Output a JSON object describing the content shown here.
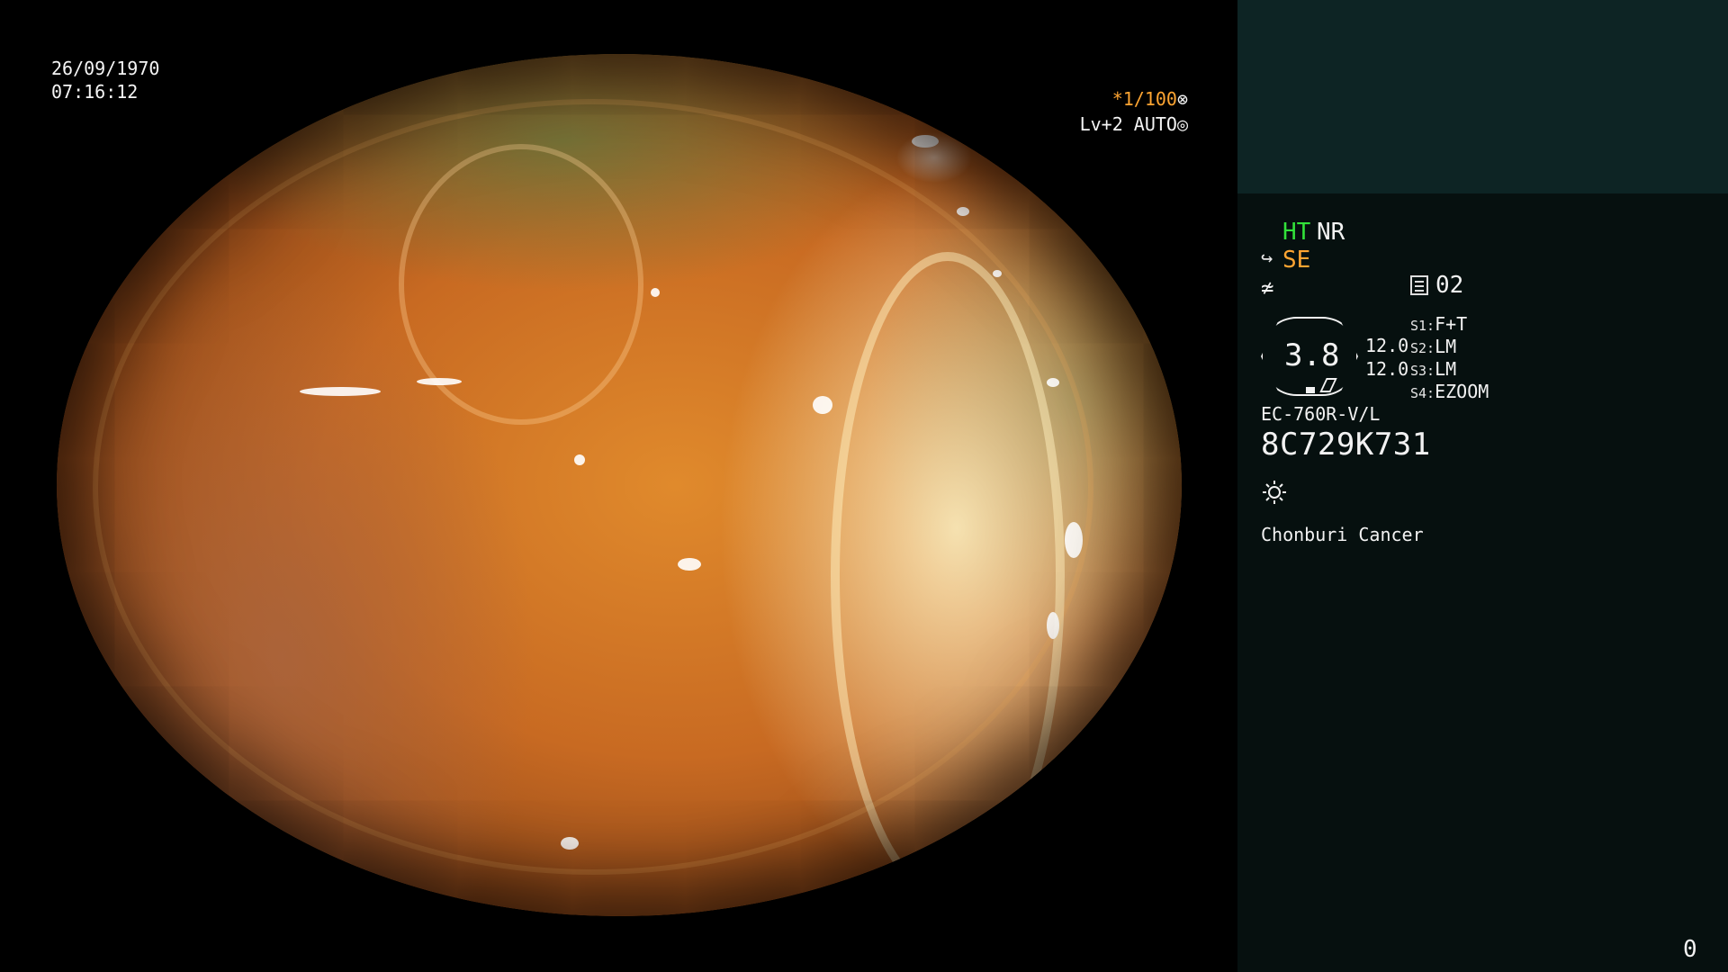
{
  "overlay": {
    "date": "26/09/1970",
    "time": "07:16:12",
    "shutter": "*1/100",
    "shutter_icon": "aperture-icon",
    "iris_mode": "Lv+2 AUTO",
    "iris_icon": "iris-icon"
  },
  "panel": {
    "ht": "HT",
    "nr": "NR",
    "se": "SE",
    "memo_number": "02",
    "zoom": "3.8",
    "mag_top": "12.0",
    "mag_bottom": "12.0",
    "switches": [
      {
        "key": "S1:",
        "value": "F+T"
      },
      {
        "key": "S2:",
        "value": "LM"
      },
      {
        "key": "S3:",
        "value": "LM"
      },
      {
        "key": "S4:",
        "value": "EZOOM"
      }
    ],
    "scope_model": "EC-760R-V/L",
    "serial": "8C729K731",
    "hospital": "Chonburi Cancer",
    "page_counter": "0"
  },
  "colors": {
    "accent_green": "#32e23a",
    "accent_orange": "#ffa532",
    "panel_bg": "#06100f",
    "panel_header_bg": "#0d2424"
  }
}
